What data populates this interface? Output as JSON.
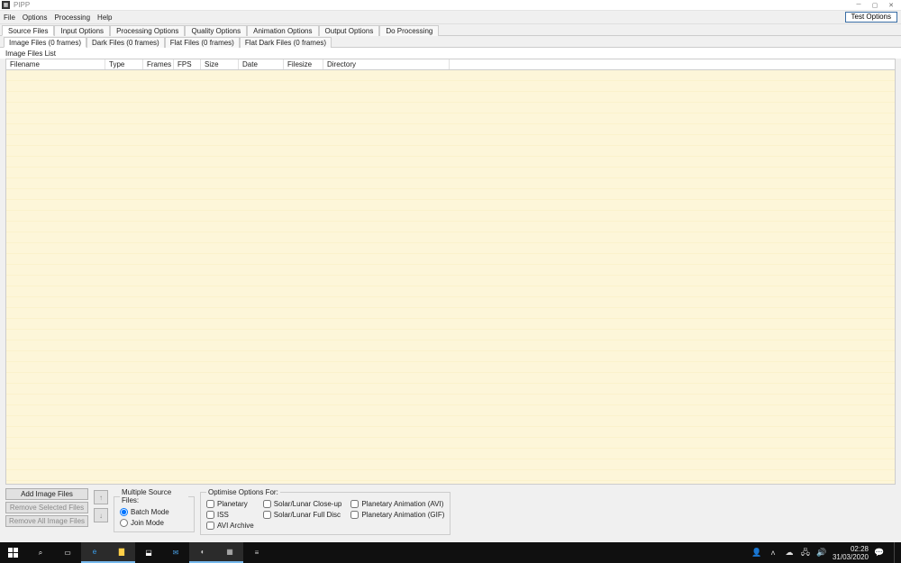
{
  "title": "PIPP",
  "menubar": [
    "File",
    "Options",
    "Processing",
    "Help"
  ],
  "test_options_label": "Test Options",
  "main_tabs": [
    "Source Files",
    "Input Options",
    "Processing Options",
    "Quality Options",
    "Animation Options",
    "Output Options",
    "Do Processing"
  ],
  "main_tab_active": 0,
  "sub_tabs": [
    "Image Files (0 frames)",
    "Dark Files (0 frames)",
    "Flat Files (0 frames)",
    "Flat Dark Files (0 frames)"
  ],
  "sub_tab_active": 0,
  "panel_label": "Image Files List",
  "columns": [
    {
      "label": "Filename",
      "w": 110
    },
    {
      "label": "Type",
      "w": 42
    },
    {
      "label": "Frames",
      "w": 34
    },
    {
      "label": "FPS",
      "w": 30
    },
    {
      "label": "Size",
      "w": 42
    },
    {
      "label": "Date",
      "w": 50
    },
    {
      "label": "Filesize",
      "w": 44
    },
    {
      "label": "Directory",
      "w": 140
    }
  ],
  "buttons": {
    "add": "Add Image Files",
    "remove_sel": "Remove Selected Files",
    "remove_all": "Remove All Image Files"
  },
  "multiple_source": {
    "legend": "Multiple Source Files:",
    "batch": "Batch Mode",
    "join": "Join Mode"
  },
  "optimise": {
    "legend": "Optimise Options For:",
    "col1": [
      "Planetary",
      "ISS",
      "AVI Archive"
    ],
    "col2": [
      "Solar/Lunar Close-up",
      "Solar/Lunar Full Disc"
    ],
    "col3": [
      "Planetary Animation (AVI)",
      "Planetary Animation (GIF)"
    ]
  },
  "clock": {
    "time": "02:28",
    "date": "31/03/2020"
  }
}
